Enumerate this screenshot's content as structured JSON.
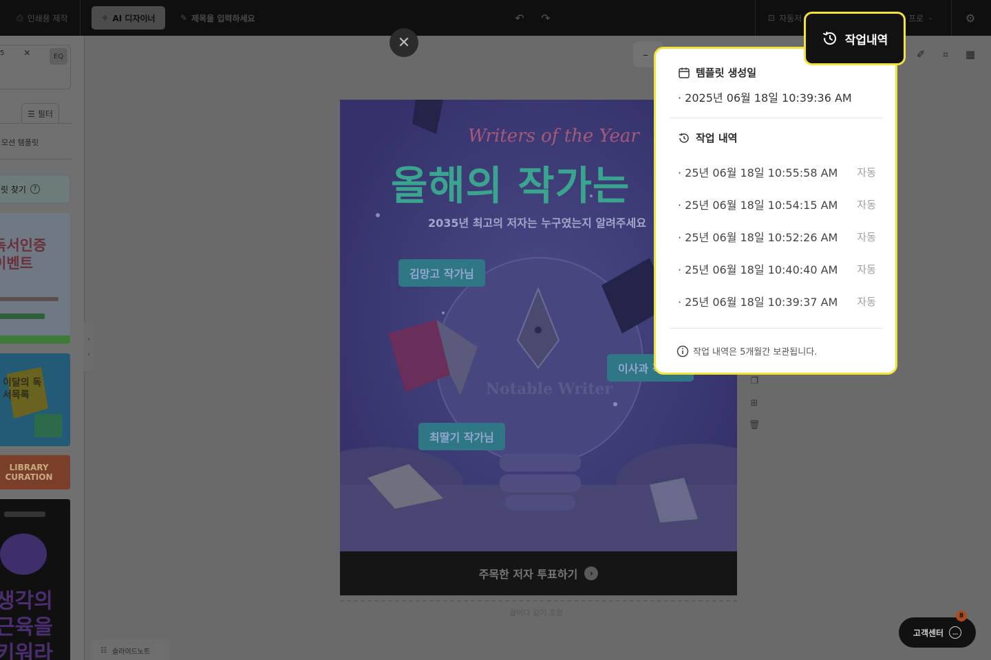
{
  "topbar": {
    "print_label": "인쇄용 제작",
    "ai_designer_label": "AI 디자이너",
    "title_placeholder": "제목을 입력하세요",
    "autosave_label": "자동저",
    "pro_label": "프로",
    "history_button_label": "작업내역"
  },
  "left_panel": {
    "search_text": "5",
    "eq_label": "EQ",
    "filter_label": "필터",
    "recommended_label": "모션 템플릿",
    "find_label": "릿 찾기",
    "collapse_prev": "‹",
    "collapse_next": "›",
    "thumbs": [
      {
        "text": "독서인증 이벤트"
      },
      {
        "text": "이달의 독서목록"
      },
      {
        "text": "LIBRARY CURATION"
      },
      {
        "text": "생각의 근육을 키워라"
      }
    ]
  },
  "canvas": {
    "close_label": "✕",
    "zoom_label": "–",
    "drag_hint": "끌어다 길이 조정"
  },
  "poster": {
    "script_title": "Writers of the Year",
    "main_title": "올해의 작가는",
    "subtitle": "2035년 최고의 저자는 누구였는지 알려주세요",
    "tags": [
      "김망고 작가님",
      "이사과 작가님",
      "최딸기 작가님"
    ],
    "notable": "Notable Writer",
    "vote_label": "주목한 저자 투표하기"
  },
  "popover": {
    "created_heading": "템플릿 생성일",
    "created_date": "· 2025년 06월 18일 10:39:36 AM",
    "history_heading": "작업 내역",
    "entries": [
      {
        "time": "· 25년 06월 18일 10:55:58 AM",
        "type": "자동"
      },
      {
        "time": "· 25년 06월 18일 10:54:15 AM",
        "type": "자동"
      },
      {
        "time": "· 25년 06월 18일 10:52:26 AM",
        "type": "자동"
      },
      {
        "time": "· 25년 06월 18일 10:40:40 AM",
        "type": "자동"
      },
      {
        "time": "· 25년 06월 18일 10:39:37 AM",
        "type": "자동"
      }
    ],
    "note": "작업 내역은 5개월간 보관됩니다."
  },
  "bottom": {
    "notes_label": "슬라이드노트",
    "help_label": "고객센터",
    "help_badge": "8"
  },
  "colors": {
    "highlight": "#f4e23a",
    "topbar_bg": "#0f0f0f",
    "overlay": "#6a6a6a"
  }
}
